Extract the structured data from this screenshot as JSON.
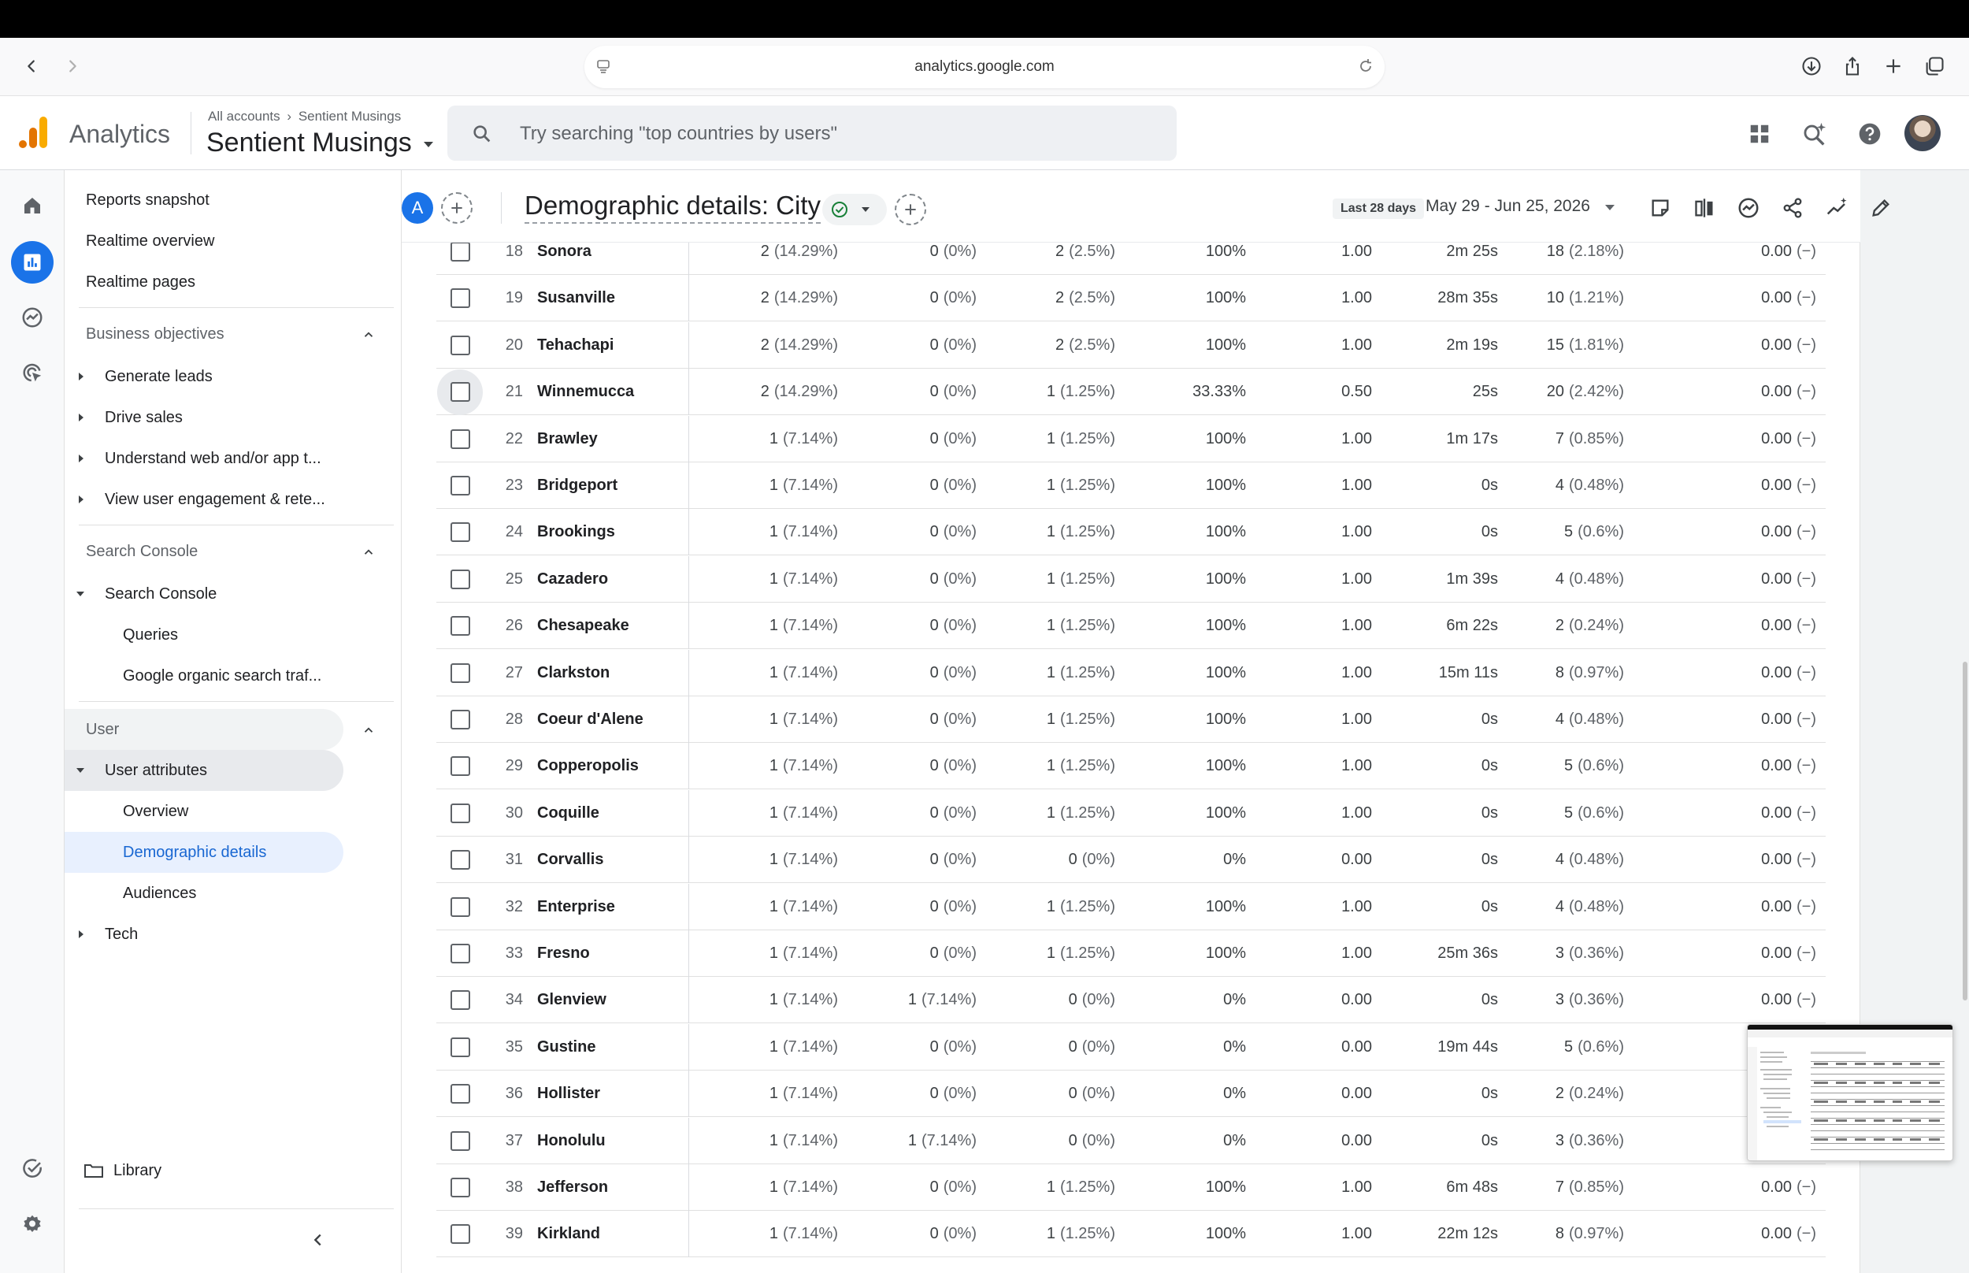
{
  "browser": {
    "url": "analytics.google.com"
  },
  "header": {
    "product": "Analytics",
    "breadcrumb_root": "All accounts",
    "breadcrumb_leaf": "Sentient Musings",
    "account": "Sentient Musings",
    "search_placeholder": "Try searching \"top countries by users\""
  },
  "sidenav": {
    "top_items": [
      "Reports snapshot",
      "Realtime overview",
      "Realtime pages"
    ],
    "business_objectives": {
      "title": "Business objectives",
      "items": [
        "Generate leads",
        "Drive sales",
        "Understand web and/or app t...",
        "View user engagement & rete..."
      ]
    },
    "search_console": {
      "title": "Search Console",
      "group": "Search Console",
      "items": [
        "Queries",
        "Google organic search traf..."
      ]
    },
    "user": {
      "title": "User",
      "group": "User attributes",
      "items": [
        "Overview",
        "Demographic details",
        "Audiences"
      ],
      "tech": "Tech"
    },
    "library": "Library"
  },
  "report": {
    "compare_badge": "A",
    "title": "Demographic details: City",
    "date_label": "Last 28 days",
    "date_range": "May 29 - Jun 25, 2026"
  },
  "table": {
    "rows": [
      {
        "idx": "18",
        "city": "Sonora",
        "c1": "2",
        "p1": "(14.29%)",
        "c2": "0",
        "p2": "(0%)",
        "c3": "2",
        "p3": "(2.5%)",
        "c4": "100%",
        "c5": "1.00",
        "c6": "2m 25s",
        "c7": "18",
        "p7": "(2.18%)",
        "c8": "0.00",
        "p8": "(−)"
      },
      {
        "idx": "19",
        "city": "Susanville",
        "c1": "2",
        "p1": "(14.29%)",
        "c2": "0",
        "p2": "(0%)",
        "c3": "2",
        "p3": "(2.5%)",
        "c4": "100%",
        "c5": "1.00",
        "c6": "28m 35s",
        "c7": "10",
        "p7": "(1.21%)",
        "c8": "0.00",
        "p8": "(−)"
      },
      {
        "idx": "20",
        "city": "Tehachapi",
        "c1": "2",
        "p1": "(14.29%)",
        "c2": "0",
        "p2": "(0%)",
        "c3": "2",
        "p3": "(2.5%)",
        "c4": "100%",
        "c5": "1.00",
        "c6": "2m 19s",
        "c7": "15",
        "p7": "(1.81%)",
        "c8": "0.00",
        "p8": "(−)"
      },
      {
        "idx": "21",
        "city": "Winnemucca",
        "c1": "2",
        "p1": "(14.29%)",
        "c2": "0",
        "p2": "(0%)",
        "c3": "1",
        "p3": "(1.25%)",
        "c4": "33.33%",
        "c5": "0.50",
        "c6": "25s",
        "c7": "20",
        "p7": "(2.42%)",
        "c8": "0.00",
        "p8": "(−)"
      },
      {
        "idx": "22",
        "city": "Brawley",
        "c1": "1",
        "p1": "(7.14%)",
        "c2": "0",
        "p2": "(0%)",
        "c3": "1",
        "p3": "(1.25%)",
        "c4": "100%",
        "c5": "1.00",
        "c6": "1m 17s",
        "c7": "7",
        "p7": "(0.85%)",
        "c8": "0.00",
        "p8": "(−)"
      },
      {
        "idx": "23",
        "city": "Bridgeport",
        "c1": "1",
        "p1": "(7.14%)",
        "c2": "0",
        "p2": "(0%)",
        "c3": "1",
        "p3": "(1.25%)",
        "c4": "100%",
        "c5": "1.00",
        "c6": "0s",
        "c7": "4",
        "p7": "(0.48%)",
        "c8": "0.00",
        "p8": "(−)"
      },
      {
        "idx": "24",
        "city": "Brookings",
        "c1": "1",
        "p1": "(7.14%)",
        "c2": "0",
        "p2": "(0%)",
        "c3": "1",
        "p3": "(1.25%)",
        "c4": "100%",
        "c5": "1.00",
        "c6": "0s",
        "c7": "5",
        "p7": "(0.6%)",
        "c8": "0.00",
        "p8": "(−)"
      },
      {
        "idx": "25",
        "city": "Cazadero",
        "c1": "1",
        "p1": "(7.14%)",
        "c2": "0",
        "p2": "(0%)",
        "c3": "1",
        "p3": "(1.25%)",
        "c4": "100%",
        "c5": "1.00",
        "c6": "1m 39s",
        "c7": "4",
        "p7": "(0.48%)",
        "c8": "0.00",
        "p8": "(−)"
      },
      {
        "idx": "26",
        "city": "Chesapeake",
        "c1": "1",
        "p1": "(7.14%)",
        "c2": "0",
        "p2": "(0%)",
        "c3": "1",
        "p3": "(1.25%)",
        "c4": "100%",
        "c5": "1.00",
        "c6": "6m 22s",
        "c7": "2",
        "p7": "(0.24%)",
        "c8": "0.00",
        "p8": "(−)"
      },
      {
        "idx": "27",
        "city": "Clarkston",
        "c1": "1",
        "p1": "(7.14%)",
        "c2": "0",
        "p2": "(0%)",
        "c3": "1",
        "p3": "(1.25%)",
        "c4": "100%",
        "c5": "1.00",
        "c6": "15m 11s",
        "c7": "8",
        "p7": "(0.97%)",
        "c8": "0.00",
        "p8": "(−)"
      },
      {
        "idx": "28",
        "city": "Coeur d'Alene",
        "c1": "1",
        "p1": "(7.14%)",
        "c2": "0",
        "p2": "(0%)",
        "c3": "1",
        "p3": "(1.25%)",
        "c4": "100%",
        "c5": "1.00",
        "c6": "0s",
        "c7": "4",
        "p7": "(0.48%)",
        "c8": "0.00",
        "p8": "(−)"
      },
      {
        "idx": "29",
        "city": "Copperopolis",
        "c1": "1",
        "p1": "(7.14%)",
        "c2": "0",
        "p2": "(0%)",
        "c3": "1",
        "p3": "(1.25%)",
        "c4": "100%",
        "c5": "1.00",
        "c6": "0s",
        "c7": "5",
        "p7": "(0.6%)",
        "c8": "0.00",
        "p8": "(−)"
      },
      {
        "idx": "30",
        "city": "Coquille",
        "c1": "1",
        "p1": "(7.14%)",
        "c2": "0",
        "p2": "(0%)",
        "c3": "1",
        "p3": "(1.25%)",
        "c4": "100%",
        "c5": "1.00",
        "c6": "0s",
        "c7": "5",
        "p7": "(0.6%)",
        "c8": "0.00",
        "p8": "(−)"
      },
      {
        "idx": "31",
        "city": "Corvallis",
        "c1": "1",
        "p1": "(7.14%)",
        "c2": "0",
        "p2": "(0%)",
        "c3": "0",
        "p3": "(0%)",
        "c4": "0%",
        "c5": "0.00",
        "c6": "0s",
        "c7": "4",
        "p7": "(0.48%)",
        "c8": "0.00",
        "p8": "(−)"
      },
      {
        "idx": "32",
        "city": "Enterprise",
        "c1": "1",
        "p1": "(7.14%)",
        "c2": "0",
        "p2": "(0%)",
        "c3": "1",
        "p3": "(1.25%)",
        "c4": "100%",
        "c5": "1.00",
        "c6": "0s",
        "c7": "4",
        "p7": "(0.48%)",
        "c8": "0.00",
        "p8": "(−)"
      },
      {
        "idx": "33",
        "city": "Fresno",
        "c1": "1",
        "p1": "(7.14%)",
        "c2": "0",
        "p2": "(0%)",
        "c3": "1",
        "p3": "(1.25%)",
        "c4": "100%",
        "c5": "1.00",
        "c6": "25m 36s",
        "c7": "3",
        "p7": "(0.36%)",
        "c8": "0.00",
        "p8": "(−)"
      },
      {
        "idx": "34",
        "city": "Glenview",
        "c1": "1",
        "p1": "(7.14%)",
        "c2": "1",
        "p2": "(7.14%)",
        "c3": "0",
        "p3": "(0%)",
        "c4": "0%",
        "c5": "0.00",
        "c6": "0s",
        "c7": "3",
        "p7": "(0.36%)",
        "c8": "0.00",
        "p8": "(−)"
      },
      {
        "idx": "35",
        "city": "Gustine",
        "c1": "1",
        "p1": "(7.14%)",
        "c2": "0",
        "p2": "(0%)",
        "c3": "0",
        "p3": "(0%)",
        "c4": "0%",
        "c5": "0.00",
        "c6": "19m 44s",
        "c7": "5",
        "p7": "(0.6%)",
        "c8": "",
        "p8": ""
      },
      {
        "idx": "36",
        "city": "Hollister",
        "c1": "1",
        "p1": "(7.14%)",
        "c2": "0",
        "p2": "(0%)",
        "c3": "0",
        "p3": "(0%)",
        "c4": "0%",
        "c5": "0.00",
        "c6": "0s",
        "c7": "2",
        "p7": "(0.24%)",
        "c8": "",
        "p8": ""
      },
      {
        "idx": "37",
        "city": "Honolulu",
        "c1": "1",
        "p1": "(7.14%)",
        "c2": "1",
        "p2": "(7.14%)",
        "c3": "0",
        "p3": "(0%)",
        "c4": "0%",
        "c5": "0.00",
        "c6": "0s",
        "c7": "3",
        "p7": "(0.36%)",
        "c8": "",
        "p8": ""
      },
      {
        "idx": "38",
        "city": "Jefferson",
        "c1": "1",
        "p1": "(7.14%)",
        "c2": "0",
        "p2": "(0%)",
        "c3": "1",
        "p3": "(1.25%)",
        "c4": "100%",
        "c5": "1.00",
        "c6": "6m 48s",
        "c7": "7",
        "p7": "(0.85%)",
        "c8": "0.00",
        "p8": "(−)"
      },
      {
        "idx": "39",
        "city": "Kirkland",
        "c1": "1",
        "p1": "(7.14%)",
        "c2": "0",
        "p2": "(0%)",
        "c3": "1",
        "p3": "(1.25%)",
        "c4": "100%",
        "c5": "1.00",
        "c6": "22m 12s",
        "c7": "8",
        "p7": "(0.97%)",
        "c8": "0.00",
        "p8": "(−)"
      }
    ]
  },
  "colors": {
    "accent": "#1a73e8",
    "active_nav_bg": "#e8f0fe",
    "active_nav_text": "#1967d2",
    "logo_orange": "#f9ab00",
    "logo_dark_orange": "#e37400"
  }
}
